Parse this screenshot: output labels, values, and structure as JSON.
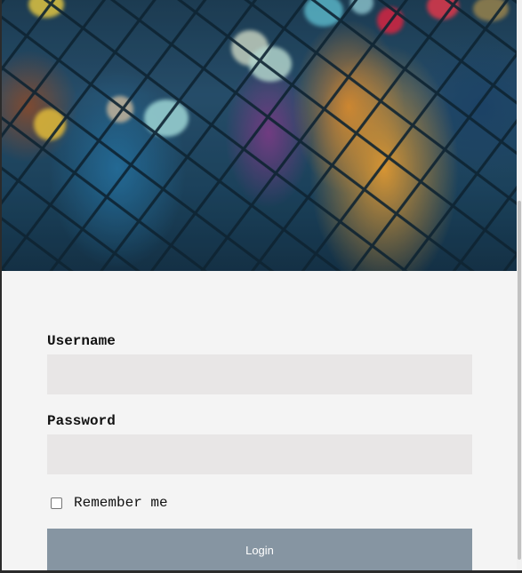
{
  "form": {
    "username_label": "Username",
    "username_value": "",
    "password_label": "Password",
    "password_value": "",
    "remember_label": "Remember me",
    "remember_checked": false,
    "login_label": "Login"
  },
  "colors": {
    "page_background": "#f4f4f4",
    "input_background": "#e8e6e6",
    "button_background": "#8695a2",
    "button_text": "#ffffff"
  },
  "icons": {
    "hero": "chain-link-fence-bokeh-image"
  }
}
